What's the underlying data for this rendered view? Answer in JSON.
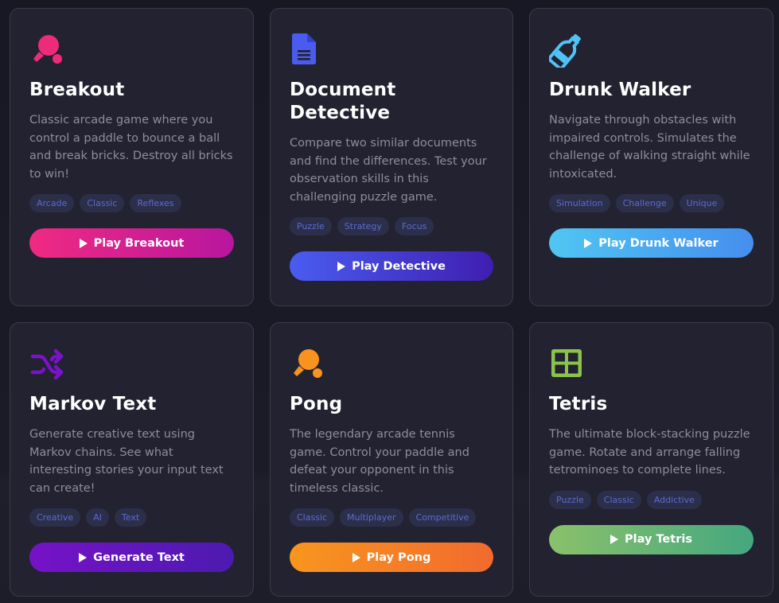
{
  "cards": [
    {
      "icon": "ping-pong-icon",
      "title": "Breakout",
      "description": "Classic arcade game where you control a paddle to bounce a ball and break bricks. Destroy all bricks to win!",
      "tags": [
        "Arcade",
        "Classic",
        "Reflexes"
      ],
      "button": "Play Breakout",
      "accent": "#ee2a7b"
    },
    {
      "icon": "document-icon",
      "title": "Document Detective",
      "description": "Compare two similar documents and find the differences. Test your observation skills in this challenging puzzle game.",
      "tags": [
        "Puzzle",
        "Strategy",
        "Focus"
      ],
      "button": "Play Detective",
      "accent": "#4a5cf0"
    },
    {
      "icon": "bottle-icon",
      "title": "Drunk Walker",
      "description": "Navigate through obstacles with impaired controls. Simulates the challenge of walking straight while intoxicated.",
      "tags": [
        "Simulation",
        "Challenge",
        "Unique"
      ],
      "button": "Play Drunk Walker",
      "accent": "#4fc3f7"
    },
    {
      "icon": "shuffle-icon",
      "title": "Markov Text",
      "description": "Generate creative text using Markov chains. See what interesting stories your input text can create!",
      "tags": [
        "Creative",
        "AI",
        "Text"
      ],
      "button": "Generate Text",
      "accent": "#7b12c9"
    },
    {
      "icon": "ping-pong-icon",
      "title": "Pong",
      "description": "The legendary arcade tennis game. Control your paddle and defeat your opponent in this timeless classic.",
      "tags": [
        "Classic",
        "Multiplayer",
        "Competitive"
      ],
      "button": "Play Pong",
      "accent": "#f7931e"
    },
    {
      "icon": "grid-icon",
      "title": "Tetris",
      "description": "The ultimate block-stacking puzzle game. Rotate and arrange falling tetrominoes to complete lines.",
      "tags": [
        "Puzzle",
        "Classic",
        "Addictive"
      ],
      "button": "Play Tetris",
      "accent": "#8bc34a"
    }
  ]
}
